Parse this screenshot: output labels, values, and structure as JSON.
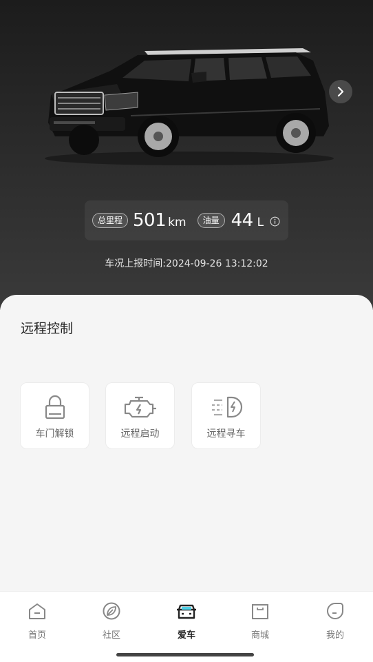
{
  "vehicle": {
    "mileage_label": "总里程",
    "mileage_value": "501",
    "mileage_unit": "km",
    "fuel_label": "油量",
    "fuel_value": "44",
    "fuel_unit": "L",
    "report_time": "车况上报时间:2024-09-26 13:12:02"
  },
  "remote": {
    "title": "远程控制",
    "items": [
      {
        "label": "车门解锁",
        "icon": "lock-icon"
      },
      {
        "label": "远程启动",
        "icon": "engine-icon"
      },
      {
        "label": "远程寻车",
        "icon": "headlight-icon"
      }
    ]
  },
  "tabs": [
    {
      "label": "首页",
      "icon": "home-icon",
      "active": false
    },
    {
      "label": "社区",
      "icon": "leaf-icon",
      "active": false
    },
    {
      "label": "爱车",
      "icon": "car-icon",
      "active": true
    },
    {
      "label": "商城",
      "icon": "shop-icon",
      "active": false
    },
    {
      "label": "我的",
      "icon": "profile-icon",
      "active": false
    }
  ],
  "colors": {
    "accent": "#4fd1e8",
    "hero_bg": "#2a2a2a"
  }
}
